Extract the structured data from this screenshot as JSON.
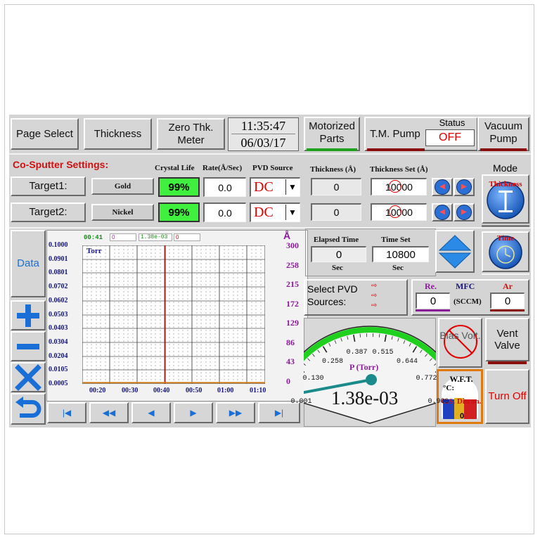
{
  "header": {
    "page_select": "Page Select",
    "thickness": "Thickness",
    "zero_thk_meter": "Zero Thk. Meter",
    "time": "11:35:47",
    "date": "06/03/17",
    "motorized_parts": "Motorized Parts",
    "tm_pump": "T.M. Pump",
    "status_label": "Status",
    "status_value": "OFF",
    "vacuum_pump": "Vacuum Pump"
  },
  "settings": {
    "title": "Co-Sputter Settings:",
    "col_crystal_life": "Crystal Life",
    "col_rate": "Rate(Å/Sec)",
    "col_pvd_source": "PVD Source",
    "col_thickness": "Thickness (Å)",
    "col_thickness_set": "Thickness Set (Å)",
    "col_mode": "Mode",
    "mode_thickness_label": "Thickness",
    "mode_time_label": "Time",
    "targets": [
      {
        "label": "Target1:",
        "material": "Gold",
        "crystal_life": "99%",
        "rate": "0.0",
        "source": "DC",
        "thickness": "0",
        "thickness_set": "10000"
      },
      {
        "label": "Target2:",
        "material": "Nickel",
        "crystal_life": "99%",
        "rate": "0.0",
        "source": "DC",
        "thickness": "0",
        "thickness_set": "10000"
      }
    ]
  },
  "chart_panel": {
    "data_button": "Data",
    "time_readout": "00:41",
    "pressure_readout": "1.38e-03",
    "field_a": "0",
    "field_b": "0",
    "angstrom_unit": "Å"
  },
  "chart_data": {
    "type": "line",
    "title": "Torr",
    "x_ticks": [
      "00:20",
      "00:30",
      "00:40",
      "00:50",
      "01:00",
      "01:10"
    ],
    "y_ticks": [
      "0.1000",
      "0.0901",
      "0.0801",
      "0.0702",
      "0.0602",
      "0.0503",
      "0.0403",
      "0.0304",
      "0.0204",
      "0.0105",
      "0.0005"
    ],
    "y2_ticks": [
      "300",
      "258",
      "215",
      "172",
      "129",
      "86",
      "43",
      "0"
    ],
    "ylim": [
      0.0005,
      0.1
    ],
    "y2lim": [
      0,
      300
    ],
    "grid": true,
    "cursor_x": "00:41",
    "series": [
      {
        "values": [
          0.0014,
          0.0014,
          0.0014,
          0.0014,
          0.0014,
          0.0014
        ],
        "color": "#d08020"
      }
    ]
  },
  "timing": {
    "elapsed_label": "Elapsed Time",
    "elapsed_value": "0",
    "elapsed_unit": "Sec",
    "timeset_label": "Time Set",
    "timeset_value": "10800",
    "timeset_unit": "Sec"
  },
  "pvd": {
    "select_label": "Select PVD Sources:"
  },
  "mfc": {
    "re_label": "Re.",
    "mfc_label": "MFC",
    "ar_label": "Ar",
    "re_value": "0",
    "unit": "(SCCM)",
    "ar_value": "0"
  },
  "gauge": {
    "label": "P (Torr)",
    "value_text": "1.38e-03",
    "ticks": [
      "0.001",
      "0.130",
      "0.258",
      "0.387",
      "0.515",
      "0.644",
      "0.772",
      "0.900"
    ],
    "min": 0.001,
    "max": 0.9,
    "value": 0.00138
  },
  "controls": {
    "bias_volt": "Bias Volt.",
    "vent_valve": "Vent Valve",
    "wft": "W.F.T.",
    "wft_unit": "°C:",
    "wft_sub": "C.S. Discon.",
    "wft_value": "0",
    "turn_off": "Turn Off"
  },
  "colors": {
    "panel_bg": "#d4d4d4",
    "accent_green": "#3ff03f",
    "accent_red": "#e00000",
    "accent_blue": "#2a6fd6",
    "title_red": "#d01010"
  }
}
